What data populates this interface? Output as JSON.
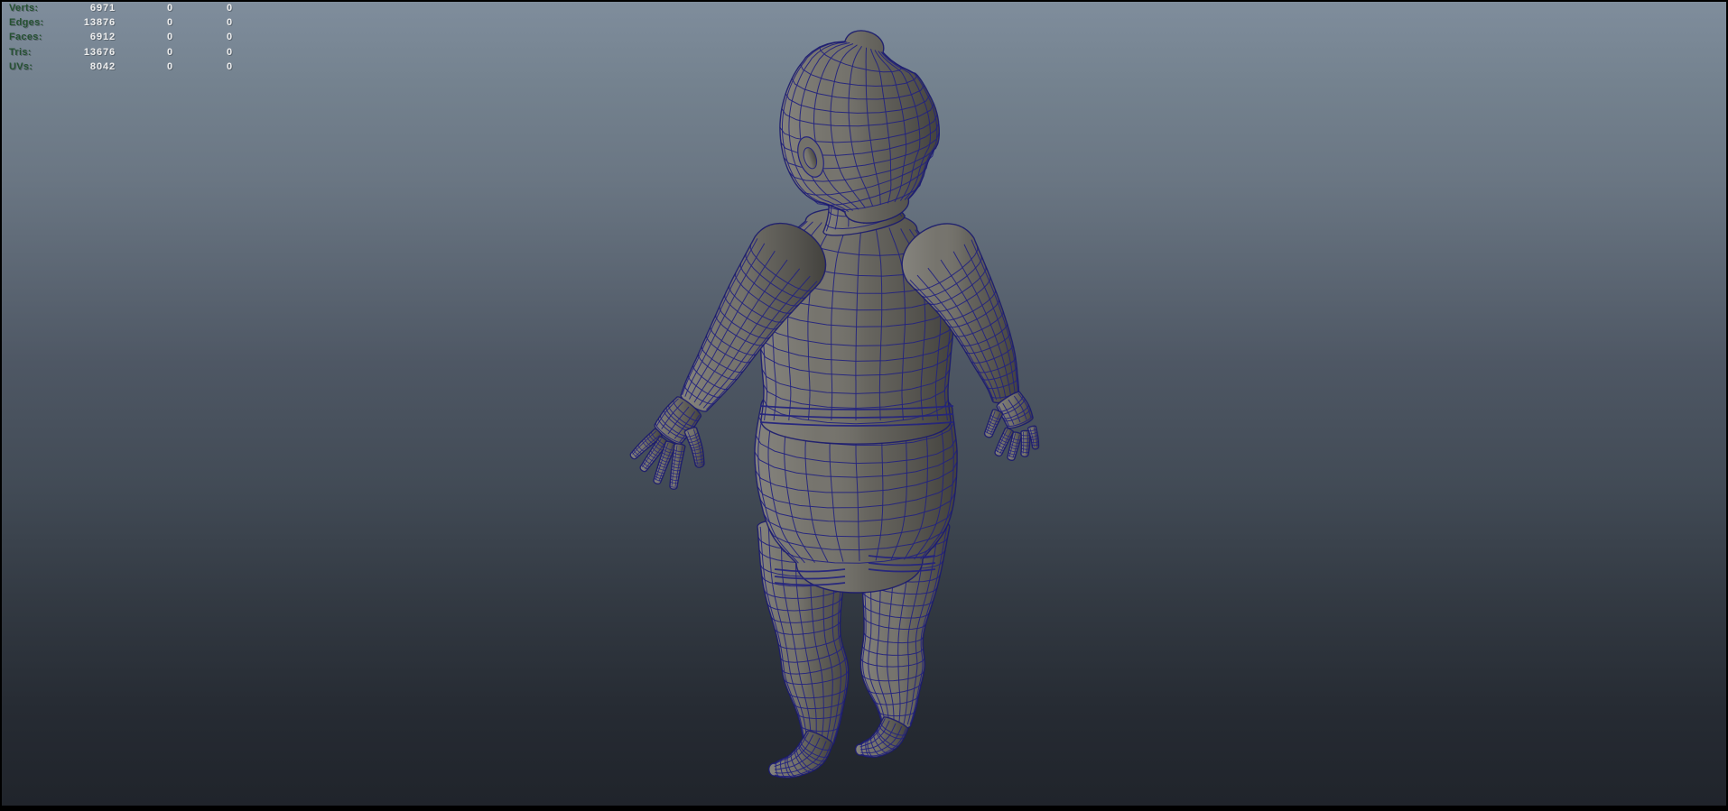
{
  "hud": {
    "rows": [
      {
        "label": "Verts:",
        "total": "6971",
        "selected": "0",
        "component": "0"
      },
      {
        "label": "Edges:",
        "total": "13876",
        "selected": "0",
        "component": "0"
      },
      {
        "label": "Faces:",
        "total": "6912",
        "selected": "0",
        "component": "0"
      },
      {
        "label": "Tris:",
        "total": "13676",
        "selected": "0",
        "component": "0"
      },
      {
        "label": "UVs:",
        "total": "8042",
        "selected": "0",
        "component": "0"
      }
    ]
  },
  "scene": {
    "subject": "child character polygon mesh",
    "view": "back view, arms spread",
    "display_mode": "wireframe on shaded"
  },
  "colors": {
    "background_top": "#7f8d9c",
    "background_mid": "#4e5764",
    "background_bottom": "#20242b",
    "frame": "#000000",
    "wireframe": "#24247e",
    "wireframe_outline": "#1b1b6e",
    "mesh_surface": "#73716a",
    "hud_label": "#265233",
    "hud_value": "#ededed"
  }
}
